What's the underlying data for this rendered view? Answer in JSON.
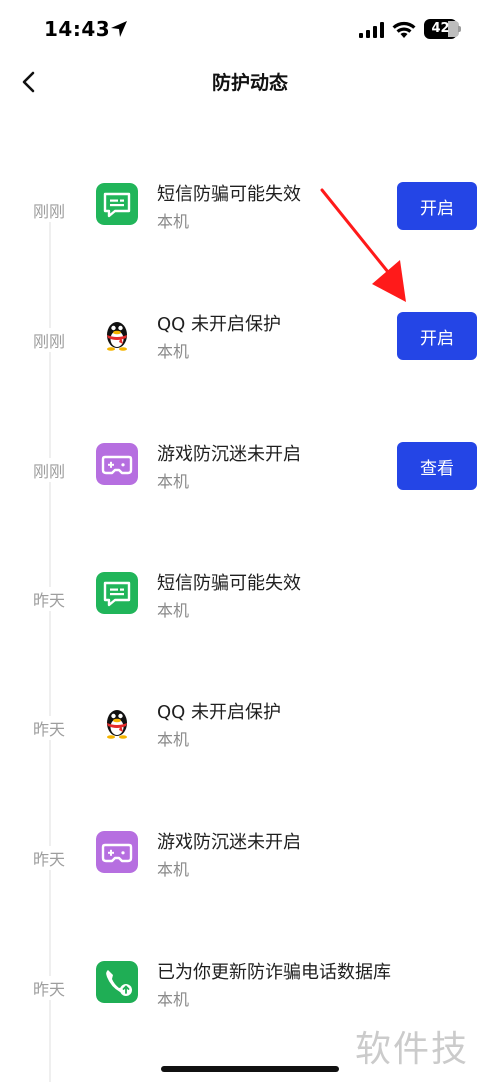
{
  "status_bar": {
    "time": "14:43",
    "battery": "42"
  },
  "nav": {
    "title": "防护动态"
  },
  "colors": {
    "accent_button": "#2445e6",
    "sms_icon": "#21b55a",
    "game_icon": "#b66fe0",
    "security_icon": "#1fae55"
  },
  "events": [
    {
      "time": "刚刚",
      "icon": "sms-icon",
      "title": "短信防骗可能失效",
      "subtitle": "本机",
      "button": "开启"
    },
    {
      "time": "刚刚",
      "icon": "qq-penguin-icon",
      "title": "QQ 未开启保护",
      "subtitle": "本机",
      "button": "开启"
    },
    {
      "time": "刚刚",
      "icon": "game-controller-icon",
      "title": "游戏防沉迷未开启",
      "subtitle": "本机",
      "button": "查看"
    },
    {
      "time": "昨天",
      "icon": "sms-icon",
      "title": "短信防骗可能失效",
      "subtitle": "本机"
    },
    {
      "time": "昨天",
      "icon": "qq-penguin-icon",
      "title": "QQ 未开启保护",
      "subtitle": "本机"
    },
    {
      "time": "昨天",
      "icon": "game-controller-icon",
      "title": "游戏防沉迷未开启",
      "subtitle": "本机"
    },
    {
      "time": "昨天",
      "icon": "phone-update-icon",
      "title": "已为你更新防诈骗电话数据库",
      "subtitle": "本机"
    }
  ],
  "watermark": "软件技巧"
}
